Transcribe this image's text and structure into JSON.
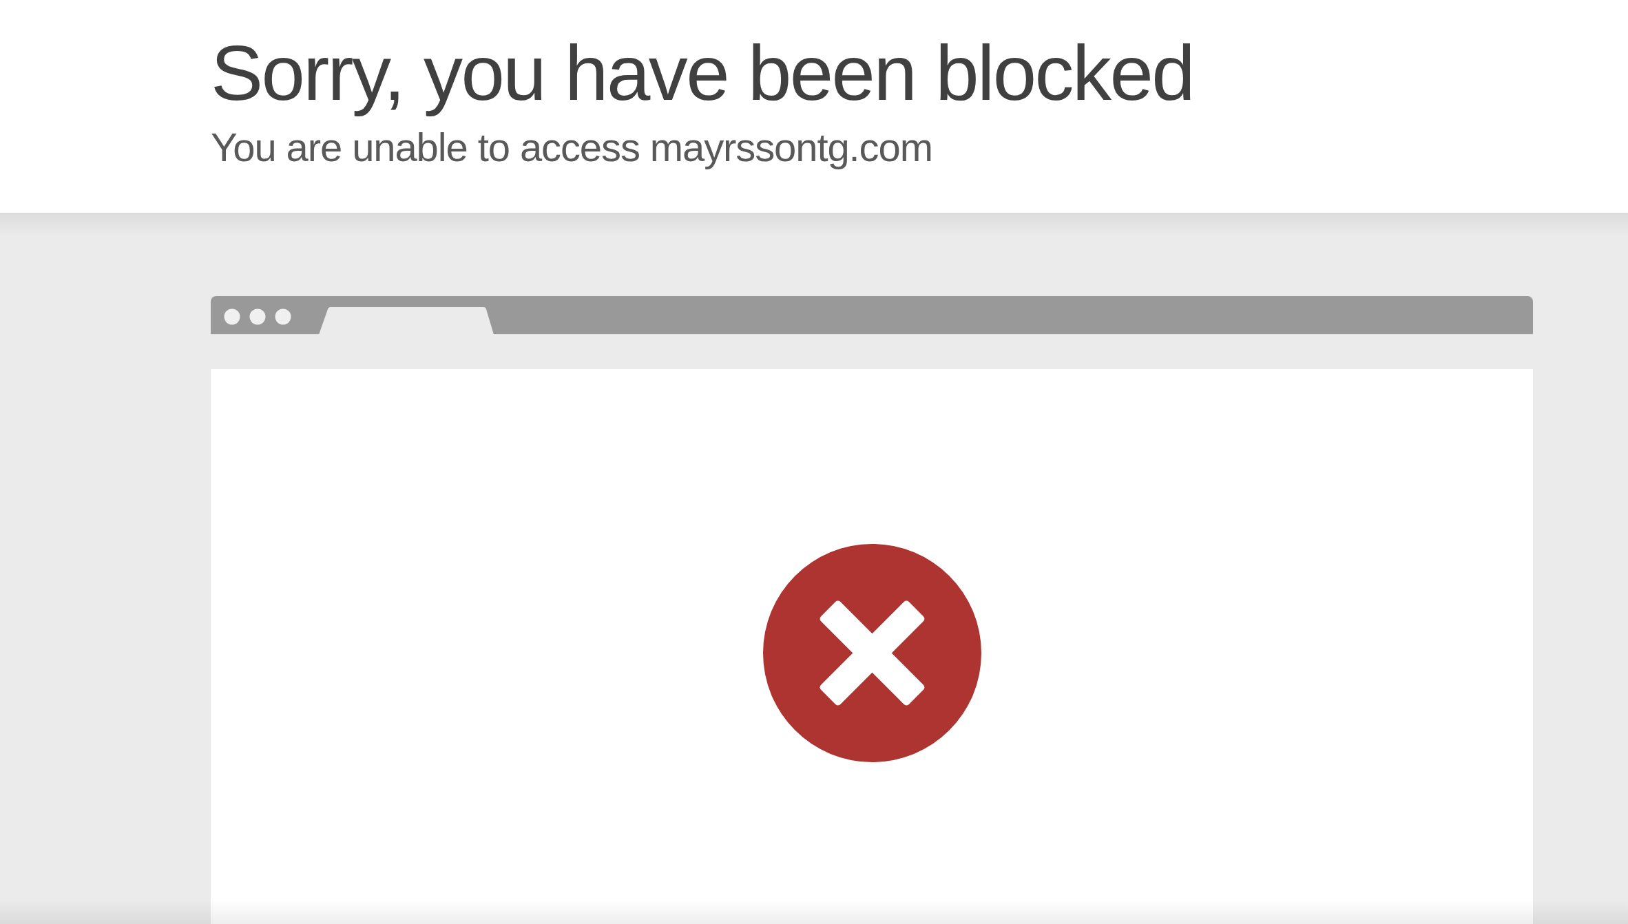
{
  "header": {
    "title": "Sorry, you have been blocked",
    "subtitle": "You are unable to access mayrssontg.com"
  }
}
